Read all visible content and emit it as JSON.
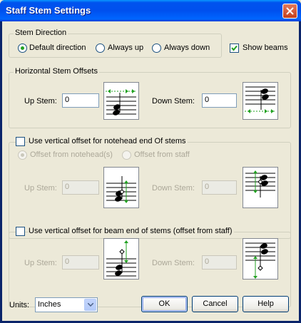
{
  "window": {
    "title": "Staff Stem Settings",
    "close_icon": "close-icon"
  },
  "stem_direction": {
    "legend": "Stem Direction",
    "options": [
      {
        "label": "Default direction",
        "checked": true
      },
      {
        "label": "Always up",
        "checked": false
      },
      {
        "label": "Always down",
        "checked": false
      }
    ],
    "show_beams": {
      "label": "Show beams",
      "checked": true
    }
  },
  "horizontal": {
    "legend": "Horizontal Stem Offsets",
    "up_label": "Up Stem:",
    "up_value": "0",
    "down_label": "Down Stem:",
    "down_value": "0"
  },
  "notehead": {
    "checkbox_label": "Use vertical offset for notehead end Of stems",
    "checked": false,
    "option_notehead": "Offset from notehead(s)",
    "option_staff": "Offset from staff",
    "up_label": "Up Stem:",
    "up_value": "0",
    "down_label": "Down Stem:",
    "down_value": "0"
  },
  "beam": {
    "checkbox_label": "Use vertical offset for beam end of stems (offset from staff)",
    "checked": false,
    "up_label": "Up Stem:",
    "up_value": "0",
    "down_label": "Down Stem:",
    "down_value": "0"
  },
  "footer": {
    "units_label": "Units:",
    "units_value": "Inches",
    "ok": "OK",
    "cancel": "Cancel",
    "help": "Help"
  },
  "colors": {
    "accent_green": "#21a121",
    "legend_blue": "#0046d5",
    "title_blue": "#0053ee"
  }
}
